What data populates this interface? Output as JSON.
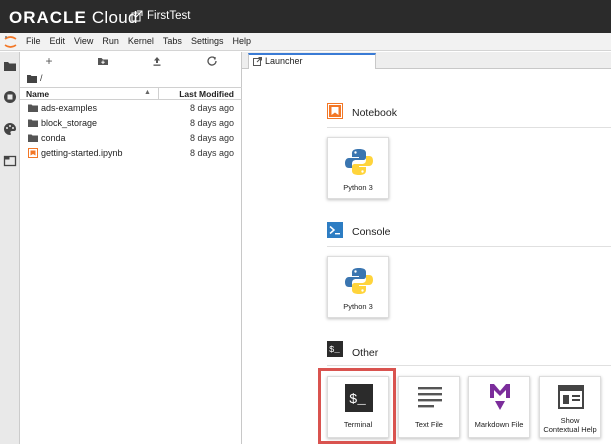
{
  "topbar": {
    "brand": "ORACLE",
    "product": "Cloud",
    "project": "FirstTest",
    "background": "#2b2b2b"
  },
  "menubar": {
    "items": [
      "File",
      "Edit",
      "View",
      "Run",
      "Kernel",
      "Tabs",
      "Settings",
      "Help"
    ]
  },
  "sidebar_icons": [
    "folder-icon",
    "running-icon",
    "palette-icon",
    "tabs-icon"
  ],
  "file_browser": {
    "toolbar": [
      "new-launcher-icon",
      "new-folder-icon",
      "upload-icon",
      "refresh-icon"
    ],
    "path": "/",
    "columns": {
      "name": "Name",
      "modified": "Last Modified"
    },
    "files": [
      {
        "name": "ads-examples",
        "modified": "8 days ago",
        "type": "folder"
      },
      {
        "name": "block_storage",
        "modified": "8 days ago",
        "type": "folder"
      },
      {
        "name": "conda",
        "modified": "8 days ago",
        "type": "folder"
      },
      {
        "name": "getting-started.ipynb",
        "modified": "8 days ago",
        "type": "notebook"
      }
    ]
  },
  "main": {
    "tab_label": "Launcher",
    "sections": {
      "notebook": {
        "title": "Notebook",
        "cards": [
          "Python 3"
        ]
      },
      "console": {
        "title": "Console",
        "cards": [
          "Python 3"
        ]
      },
      "other": {
        "title": "Other",
        "cards": [
          "Terminal",
          "Text File",
          "Markdown File",
          "Show Contextual Help"
        ]
      }
    }
  },
  "colors": {
    "accent": "#3a7bd5",
    "notebook_orange": "#f37726",
    "console_blue": "#2d7dc3",
    "markdown_purple": "#7b2d9b",
    "highlight_red": "#d9534f"
  }
}
